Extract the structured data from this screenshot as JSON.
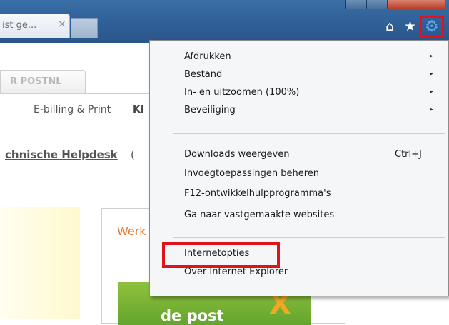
{
  "browser": {
    "tab_title": "ist ge...",
    "tab_close": "×",
    "home_icon": "⌂",
    "star_icon": "★",
    "gear_icon": "⚙"
  },
  "page": {
    "tab_label": "R POSTNL",
    "nav": [
      "E-billing & Print",
      "Kl"
    ],
    "helpdesk_link": "chnische Helpdesk",
    "helpdesk_after": "(",
    "card_title": "Werk",
    "promo_text": "de post"
  },
  "menu": {
    "items": [
      {
        "label": "Afdrukken",
        "submenu": true
      },
      {
        "label": "Bestand",
        "submenu": true
      },
      {
        "label": "In- en uitzoomen (100%)",
        "submenu": true
      },
      {
        "label": "Beveiliging",
        "submenu": true
      },
      {
        "label": "Downloads weergeven",
        "shortcut": "Ctrl+J"
      },
      {
        "label": "Invoegtoepassingen beheren"
      },
      {
        "label": "F12-ontwikkelhulpprogramma's"
      },
      {
        "label": "Ga naar vastgemaakte websites"
      },
      {
        "label": "Internetopties"
      },
      {
        "label": "Over Internet Explorer"
      }
    ],
    "arrow": "▸"
  },
  "colors": {
    "highlight": "#e0131d",
    "titlebar": "#2f5f96",
    "accent_orange": "#e8792c"
  }
}
